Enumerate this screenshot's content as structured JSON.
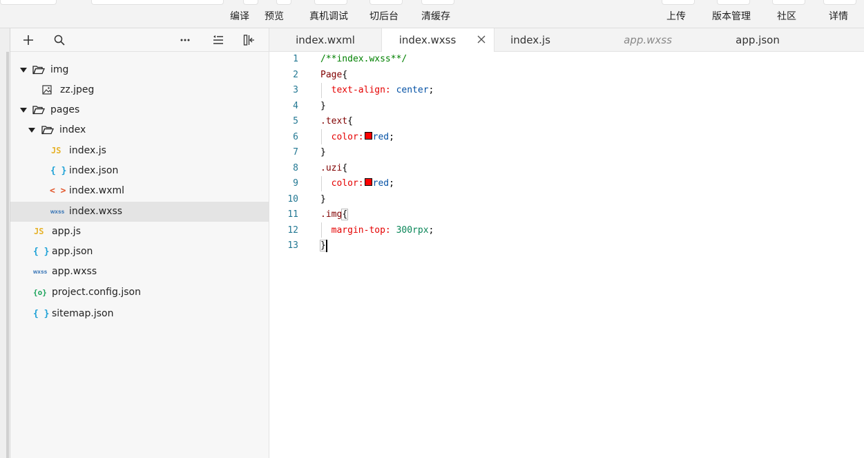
{
  "toolbar": {
    "compile": "编译",
    "preview": "预览",
    "remote_debug": "真机调试",
    "background": "切后台",
    "clear_cache": "清缓存",
    "upload": "上传",
    "version_mgmt": "版本管理",
    "community": "社区",
    "details": "详情"
  },
  "explorer": {
    "items": [
      {
        "label": "img",
        "kind": "folder",
        "icon": "folder-open-icon"
      },
      {
        "label": "zz.jpeg",
        "kind": "file",
        "icon": "image-file-icon"
      },
      {
        "label": "pages",
        "kind": "folder",
        "icon": "folder-open-icon"
      },
      {
        "label": "index",
        "kind": "folder",
        "icon": "folder-open-icon"
      },
      {
        "label": "index.js",
        "kind": "file",
        "icon": "js-file-icon",
        "badge": "JS"
      },
      {
        "label": "index.json",
        "kind": "file",
        "icon": "json-file-icon",
        "badge": "{ }"
      },
      {
        "label": "index.wxml",
        "kind": "file",
        "icon": "wxml-file-icon",
        "badge": "< >"
      },
      {
        "label": "index.wxss",
        "kind": "file",
        "icon": "wxss-file-icon",
        "badge": "wxss",
        "selected": true
      },
      {
        "label": "app.js",
        "kind": "file",
        "icon": "js-file-icon",
        "badge": "JS"
      },
      {
        "label": "app.json",
        "kind": "file",
        "icon": "json-file-icon",
        "badge": "{ }"
      },
      {
        "label": "app.wxss",
        "kind": "file",
        "icon": "wxss-file-icon",
        "badge": "wxss"
      },
      {
        "label": "project.config.json",
        "kind": "file",
        "icon": "config-file-icon",
        "badge": "{o}"
      },
      {
        "label": "sitemap.json",
        "kind": "file",
        "icon": "json-file-icon",
        "badge": "{ }"
      }
    ]
  },
  "tabs": [
    {
      "label": "index.wxml",
      "active": false,
      "preview": false
    },
    {
      "label": "index.wxss",
      "active": true,
      "preview": false
    },
    {
      "label": "index.js",
      "active": false,
      "preview": false
    },
    {
      "label": "app.wxss",
      "active": false,
      "preview": true
    },
    {
      "label": "app.json",
      "active": false,
      "preview": false
    }
  ],
  "editor": {
    "line_numbers": [
      "1",
      "2",
      "3",
      "4",
      "5",
      "6",
      "7",
      "8",
      "9",
      "10",
      "11",
      "12",
      "13"
    ],
    "lines": {
      "l1": "/**index.wxss**/",
      "l2_sel": "Page",
      "l2_brace": "{",
      "l3_prop": "text-align:",
      "l3_val": " center",
      "l3_end": ";",
      "l4": "}",
      "l5_sel": ".text",
      "l5_brace": "{",
      "l6_prop": "color:",
      "l6_val": "red",
      "l6_end": ";",
      "l7": "}",
      "l8_sel": ".uzi",
      "l8_brace": "{",
      "l9_prop": "color:",
      "l9_val": "red",
      "l9_end": ";",
      "l10": "}",
      "l11_sel": ".img",
      "l11_brace": "{",
      "l12_prop": "margin-top:",
      "l12_val": " 300rpx",
      "l12_end": ";",
      "l13": "}"
    },
    "swatch_color": "#ff0000"
  }
}
